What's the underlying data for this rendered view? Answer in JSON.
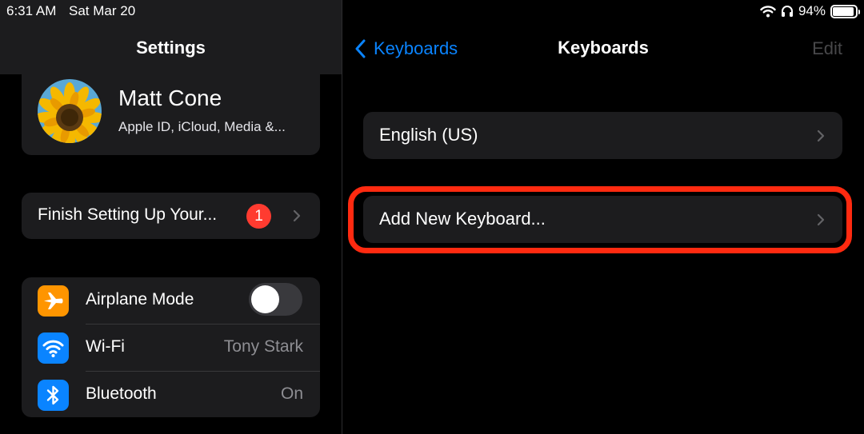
{
  "status_bar": {
    "time": "6:31 AM",
    "date": "Sat Mar 20",
    "battery_percent": "94%",
    "battery_level": 0.94
  },
  "sidebar": {
    "title": "Settings",
    "profile": {
      "name": "Matt Cone",
      "subtitle": "Apple ID, iCloud, Media &..."
    },
    "finish_setup": {
      "label": "Finish Setting Up Your...",
      "badge": "1"
    },
    "items": [
      {
        "label": "Airplane Mode",
        "icon": "airplane-icon",
        "color": "#ff9500",
        "toggle_on": false
      },
      {
        "label": "Wi-Fi",
        "value": "Tony Stark",
        "icon": "wifi-icon",
        "color": "#0a84ff"
      },
      {
        "label": "Bluetooth",
        "value": "On",
        "icon": "bluetooth-icon",
        "color": "#0a84ff"
      }
    ]
  },
  "detail": {
    "back_label": "Keyboards",
    "title": "Keyboards",
    "edit_label": "Edit",
    "keyboards": [
      {
        "label": "English (US)"
      }
    ],
    "add_keyboard_label": "Add New Keyboard..."
  },
  "colors": {
    "accent": "#0a84ff",
    "highlight": "#ff2a10",
    "badge": "#ff3b30"
  }
}
